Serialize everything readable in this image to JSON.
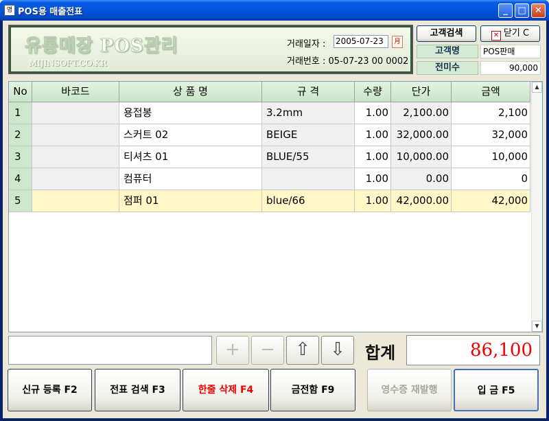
{
  "window": {
    "title": "POS용 매출전표",
    "app_icon": "영",
    "minimize": "_",
    "maximize": "□",
    "close": "✕"
  },
  "logo": {
    "title": "유통매장 POS관리",
    "subtitle": "MIJINSOFT.CO.KR"
  },
  "trade": {
    "date_label": "거래일자 :",
    "date_value": "2005-07-23",
    "calendar_glyph": "月",
    "number_text": "거래번호 : 05-07-23 00 0002"
  },
  "customer": {
    "search_button": "고객검색",
    "close_button": "닫기 C",
    "name_label": "고객명",
    "name_value": "POS판매",
    "unpaid_label": "전미수",
    "unpaid_value": "90,000"
  },
  "grid": {
    "headers": [
      "No",
      "바코드",
      "상 품 명",
      "규 격",
      "수량",
      "단가",
      "금액"
    ],
    "rows": [
      {
        "no": "1",
        "barcode": "",
        "name": "용접봉",
        "spec": "3.2mm",
        "qty": "1.00",
        "price": "2,100.00",
        "amount": "2,100"
      },
      {
        "no": "2",
        "barcode": "",
        "name": "스커트 02",
        "spec": "BEIGE",
        "qty": "1.00",
        "price": "32,000.00",
        "amount": "32,000"
      },
      {
        "no": "3",
        "barcode": "",
        "name": "티셔츠 01",
        "spec": "BLUE/55",
        "qty": "1.00",
        "price": "10,000.00",
        "amount": "10,000"
      },
      {
        "no": "4",
        "barcode": "",
        "name": "컴퓨터",
        "spec": "",
        "qty": "1.00",
        "price": "0.00",
        "amount": "0"
      },
      {
        "no": "5",
        "barcode": "",
        "name": "점퍼 01",
        "spec": "blue/66",
        "qty": "1.00",
        "price": "42,000.00",
        "amount": "42,000"
      }
    ],
    "selected_row": 5
  },
  "controls": {
    "plus": "+",
    "minus": "−",
    "up": "⇧",
    "down": "⇩",
    "total_label": "합계",
    "total_value": "86,100"
  },
  "buttons": {
    "new": "신규 등록 F2",
    "search_slip": "전표 검색 F3",
    "delete_row": "한줄 삭제 F4",
    "drawer": "금전함 F9",
    "reprint": "영수증 재발행",
    "deposit": "입   금 F5"
  },
  "colors": {
    "total_text": "#e00000",
    "delete_text": "#e00000",
    "selected_row": "#fff7c8",
    "header_green": "#cde7cd"
  }
}
